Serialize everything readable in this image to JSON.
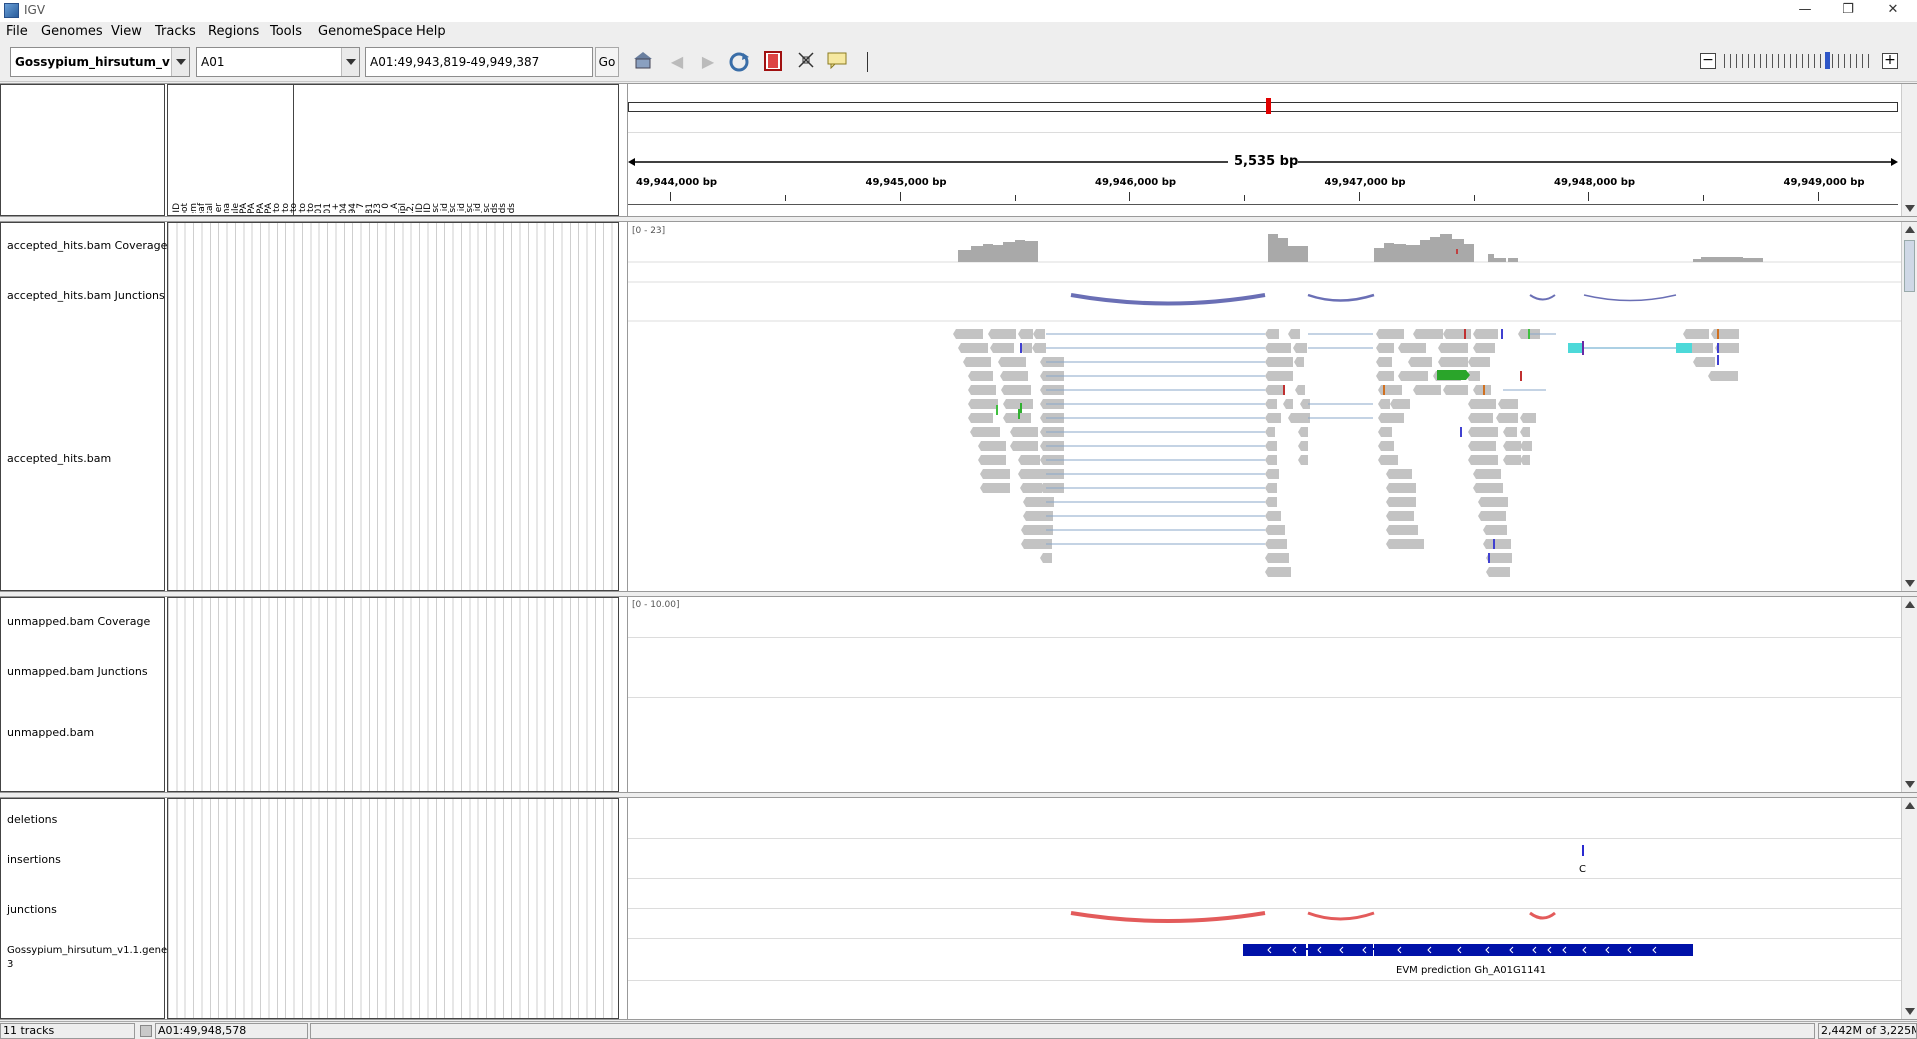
{
  "window": {
    "title": "IGV"
  },
  "menu": [
    "File",
    "Genomes",
    "View",
    "Tracks",
    "Regions",
    "Tools",
    "GenomeSpace",
    "Help"
  ],
  "toolbar": {
    "genome": "Gossypium_hirsutum_v...",
    "chromosome": "A01",
    "locus": "A01:49,943,819-49,949,387",
    "go_label": "Go"
  },
  "attributes": [
    "GeneID",
    "GhRoot",
    "GhStem",
    "GhLeaf",
    "GhPetal",
    "GhAnther",
    "GhStigma",
    "GhOvule",
    "GhFiber10DPA",
    "GhFiber20DPA",
    "GhSeed10DPA",
    "GhSeed20DPA",
    "24h-Cyto",
    "48h-Cyto",
    "72h-Cyto",
    "96h-Cyto",
    "120h-Cyto",
    "evm.model.Gh_A01G0001",
    "A01",
    "+",
    "15704",
    "19194",
    "7",
    "15704,16263,16883,17481",
    "15772,16319,17103,17623",
    "0",
    "EVM%20prediction%20Gh_A",
    "incmpl",
    "0,2,1,2,1,0,2,",
    "G.hirsutum gene ID",
    "Arabidopsis ID",
    "AraDesc",
    "Swissprot_id",
    "Swissprot_desc",
    "Trembl_id",
    "Trembl_desc",
    "KEGG_id",
    "KEGG_desc",
    "Pfam_ids",
    "InterPro_ids",
    "GO_ids"
  ],
  "ruler": {
    "span": "5,535 bp",
    "ticks": [
      "49,944,000 bp",
      "49,945,000 bp",
      "49,946,000 bp",
      "49,947,000 bp",
      "49,948,000 bp",
      "49,949,000 bp"
    ]
  },
  "panels": {
    "accepted": {
      "coverage_name": "accepted_hits.bam Coverage",
      "coverage_range": "[0 - 23]",
      "junctions_name": "accepted_hits.bam Junctions",
      "bam_name": "accepted_hits.bam"
    },
    "unmapped": {
      "coverage_name": "unmapped.bam Coverage",
      "coverage_range": "[0 - 10.00]",
      "junctions_name": "unmapped.bam Junctions",
      "bam_name": "unmapped.bam"
    },
    "features": {
      "deletions_name": "deletions",
      "insertions_name": "insertions",
      "insertion_base": "C",
      "junctions_name": "junctions",
      "gene_track_name_1": "Gossypium_hirsutum_v1.1.gene.",
      "gene_track_name_2": "3",
      "gene_label": "EVM prediction Gh_A01G1141"
    }
  },
  "status": {
    "tracks": "11 tracks",
    "position": "A01:49,948,578",
    "memory": "2,442M of 3,225M"
  },
  "colors": {
    "coverage": "#a9a9a9",
    "read": "#c3c3c3",
    "junction_blue": "#6a6fb5",
    "junction_red": "#e35b5b",
    "gene": "#0011a8",
    "highlight_green": "#2aa52a",
    "highlight_cyan": "#4dd9d9"
  }
}
